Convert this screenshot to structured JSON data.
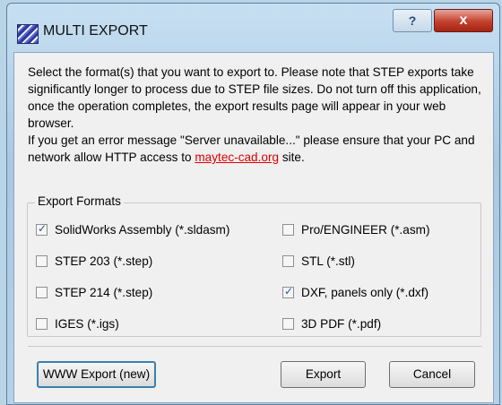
{
  "window": {
    "title": "MULTI EXPORT",
    "help_label": "?",
    "close_label": "x"
  },
  "message": {
    "paragraph1": "Select the format(s) that you want to export to. Please note that STEP exports take significantly longer to process due to STEP file sizes. Do not turn off this application, once the operation completes, the export results page will appear in your web browser.",
    "paragraph2_prefix": "If you get an error message \"Server unavailable...\" please ensure that your PC and network allow HTTP access to ",
    "link_text": "maytec-cad.org",
    "paragraph2_suffix": " site."
  },
  "export_formats": {
    "title": "Export Formats",
    "options": [
      {
        "label": "SolidWorks Assembly (*.sldasm)",
        "checked": true
      },
      {
        "label": "STEP 203 (*.step)",
        "checked": false
      },
      {
        "label": "STEP 214 (*.step)",
        "checked": false
      },
      {
        "label": "IGES (*.igs)",
        "checked": false
      },
      {
        "label": "Pro/ENGINEER (*.asm)",
        "checked": false
      },
      {
        "label": "STL (*.stl)",
        "checked": false
      },
      {
        "label": "DXF, panels only (*.dxf)",
        "checked": true
      },
      {
        "label": "3D PDF (*.pdf)",
        "checked": false
      }
    ]
  },
  "buttons": {
    "www_export": "WWW Export (new)",
    "export": "Export",
    "cancel": "Cancel"
  },
  "colors": {
    "link": "#e00000",
    "close_button": "#c4402c",
    "check_mark": "#2456a6"
  }
}
